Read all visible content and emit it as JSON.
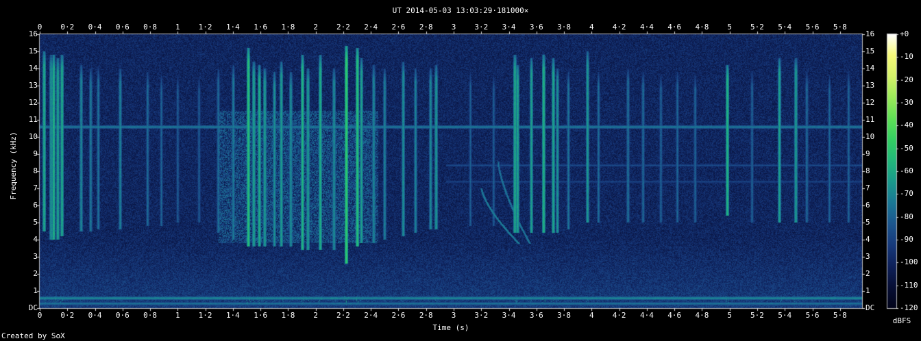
{
  "title": "UT 2014-05-03 13:03:29·181000×",
  "credit": "Created by SoX",
  "chart_data": {
    "type": "heatmap",
    "xlabel": "Time (s)",
    "ylabel": "Frequency (kHz)",
    "xlim": [
      0,
      5.96
    ],
    "ylim": [
      0,
      16
    ],
    "x_ticks": [
      "0",
      "0·2",
      "0·4",
      "0·6",
      "0·8",
      "1",
      "1·2",
      "1·4",
      "1·6",
      "1·8",
      "2",
      "2·2",
      "2·4",
      "2·6",
      "2·8",
      "3",
      "3·2",
      "3·4",
      "3·6",
      "3·8",
      "4",
      "4·2",
      "4·4",
      "4·6",
      "4·8",
      "5",
      "5·2",
      "5·4",
      "5·6",
      "5·8"
    ],
    "y_ticks": [
      "DC",
      "1",
      "2",
      "3",
      "4",
      "5",
      "6",
      "7",
      "8",
      "9",
      "10",
      "11",
      "12",
      "13",
      "14",
      "15",
      "16"
    ],
    "colorbar": {
      "unit": "dBFS",
      "range": [
        -120,
        0
      ],
      "ticks": [
        "+0",
        "-10",
        "-20",
        "-30",
        "-40",
        "-50",
        "-60",
        "-70",
        "-80",
        "-90",
        "-100",
        "-110",
        "-120"
      ],
      "colors": [
        "#ffffff",
        "#f6f97a",
        "#d5f26a",
        "#9cea5a",
        "#5fdf56",
        "#34cf63",
        "#22b87b",
        "#1a9a8c",
        "#1a7896",
        "#1c568e",
        "#173a7c",
        "#0e215a",
        "#070f35",
        "#02041a"
      ]
    },
    "background_level_dBFS": -100,
    "horizontal_lines": [
      {
        "freq_khz": 10.6,
        "level": -72,
        "x_range": [
          0,
          5.96
        ]
      },
      {
        "freq_khz": 8.35,
        "level": -86,
        "x_range": [
          2.95,
          5.96
        ]
      },
      {
        "freq_khz": 7.4,
        "level": -88,
        "x_range": [
          2.95,
          5.96
        ]
      },
      {
        "freq_khz": 0.6,
        "level": -68,
        "x_range": [
          0,
          5.96
        ]
      },
      {
        "freq_khz": 0.3,
        "level": -74,
        "x_range": [
          0,
          5.96
        ]
      }
    ],
    "vertical_impulses": [
      {
        "t": 0.03,
        "f_min": 4.5,
        "f_max": 15.0,
        "level": -58
      },
      {
        "t": 0.08,
        "f_min": 4.0,
        "f_max": 14.8,
        "level": -64
      },
      {
        "t": 0.1,
        "f_min": 4.0,
        "f_max": 14.8,
        "level": -56
      },
      {
        "t": 0.13,
        "f_min": 4.0,
        "f_max": 14.6,
        "level": -60
      },
      {
        "t": 0.16,
        "f_min": 4.2,
        "f_max": 14.8,
        "level": -58
      },
      {
        "t": 0.3,
        "f_min": 4.5,
        "f_max": 14.2,
        "level": -68
      },
      {
        "t": 0.37,
        "f_min": 4.5,
        "f_max": 14.0,
        "level": -72
      },
      {
        "t": 0.42,
        "f_min": 4.6,
        "f_max": 14.0,
        "level": -74
      },
      {
        "t": 0.58,
        "f_min": 4.6,
        "f_max": 14.0,
        "level": -70
      },
      {
        "t": 0.78,
        "f_min": 4.8,
        "f_max": 13.8,
        "level": -76
      },
      {
        "t": 0.88,
        "f_min": 4.8,
        "f_max": 13.6,
        "level": -78
      },
      {
        "t": 1.0,
        "f_min": 5.0,
        "f_max": 13.6,
        "level": -80
      },
      {
        "t": 1.15,
        "f_min": 5.0,
        "f_max": 13.5,
        "level": -80
      },
      {
        "t": 1.29,
        "f_min": 4.4,
        "f_max": 14.0,
        "level": -76
      },
      {
        "t": 1.4,
        "f_min": 4.0,
        "f_max": 14.2,
        "level": -72
      },
      {
        "t": 1.51,
        "f_min": 3.6,
        "f_max": 15.2,
        "level": -52
      },
      {
        "t": 1.55,
        "f_min": 3.6,
        "f_max": 14.4,
        "level": -60
      },
      {
        "t": 1.59,
        "f_min": 3.6,
        "f_max": 14.2,
        "level": -58
      },
      {
        "t": 1.63,
        "f_min": 3.6,
        "f_max": 14.0,
        "level": -62
      },
      {
        "t": 1.7,
        "f_min": 3.6,
        "f_max": 13.8,
        "level": -66
      },
      {
        "t": 1.75,
        "f_min": 3.6,
        "f_max": 14.4,
        "level": -62
      },
      {
        "t": 1.82,
        "f_min": 3.6,
        "f_max": 13.8,
        "level": -66
      },
      {
        "t": 1.9,
        "f_min": 3.4,
        "f_max": 14.8,
        "level": -56
      },
      {
        "t": 1.94,
        "f_min": 3.4,
        "f_max": 14.0,
        "level": -62
      },
      {
        "t": 2.03,
        "f_min": 3.4,
        "f_max": 14.8,
        "level": -58
      },
      {
        "t": 2.13,
        "f_min": 3.4,
        "f_max": 14.0,
        "level": -66
      },
      {
        "t": 2.22,
        "f_min": 2.6,
        "f_max": 15.3,
        "level": -48
      },
      {
        "t": 2.3,
        "f_min": 3.6,
        "f_max": 15.2,
        "level": -52
      },
      {
        "t": 2.33,
        "f_min": 3.8,
        "f_max": 14.6,
        "level": -62
      },
      {
        "t": 2.42,
        "f_min": 3.8,
        "f_max": 14.2,
        "level": -68
      },
      {
        "t": 2.5,
        "f_min": 4.0,
        "f_max": 14.0,
        "level": -70
      },
      {
        "t": 2.63,
        "f_min": 4.2,
        "f_max": 14.4,
        "level": -66
      },
      {
        "t": 2.72,
        "f_min": 4.4,
        "f_max": 14.0,
        "level": -70
      },
      {
        "t": 2.83,
        "f_min": 4.6,
        "f_max": 14.0,
        "level": -68
      },
      {
        "t": 2.87,
        "f_min": 4.6,
        "f_max": 14.2,
        "level": -64
      },
      {
        "t": 3.12,
        "f_min": 4.8,
        "f_max": 13.8,
        "level": -80
      },
      {
        "t": 3.29,
        "f_min": 4.8,
        "f_max": 13.6,
        "level": -80
      },
      {
        "t": 3.44,
        "f_min": 4.4,
        "f_max": 14.8,
        "level": -58
      },
      {
        "t": 3.46,
        "f_min": 4.4,
        "f_max": 14.2,
        "level": -60
      },
      {
        "t": 3.56,
        "f_min": 4.4,
        "f_max": 14.6,
        "level": -62
      },
      {
        "t": 3.65,
        "f_min": 4.4,
        "f_max": 14.8,
        "level": -56
      },
      {
        "t": 3.72,
        "f_min": 4.4,
        "f_max": 14.6,
        "level": -60
      },
      {
        "t": 3.75,
        "f_min": 4.4,
        "f_max": 14.0,
        "level": -66
      },
      {
        "t": 3.83,
        "f_min": 4.6,
        "f_max": 13.8,
        "level": -74
      },
      {
        "t": 3.97,
        "f_min": 5.0,
        "f_max": 15.0,
        "level": -64
      },
      {
        "t": 4.05,
        "f_min": 5.0,
        "f_max": 13.8,
        "level": -76
      },
      {
        "t": 4.26,
        "f_min": 5.0,
        "f_max": 14.0,
        "level": -74
      },
      {
        "t": 4.37,
        "f_min": 5.0,
        "f_max": 13.8,
        "level": -76
      },
      {
        "t": 4.5,
        "f_min": 5.0,
        "f_max": 13.6,
        "level": -78
      },
      {
        "t": 4.62,
        "f_min": 5.0,
        "f_max": 13.8,
        "level": -78
      },
      {
        "t": 4.75,
        "f_min": 5.0,
        "f_max": 13.6,
        "level": -78
      },
      {
        "t": 4.98,
        "f_min": 5.4,
        "f_max": 14.2,
        "level": -56
      },
      {
        "t": 5.16,
        "f_min": 5.0,
        "f_max": 13.8,
        "level": -78
      },
      {
        "t": 5.36,
        "f_min": 5.0,
        "f_max": 14.6,
        "level": -62
      },
      {
        "t": 5.48,
        "f_min": 5.0,
        "f_max": 14.6,
        "level": -62
      },
      {
        "t": 5.56,
        "f_min": 5.0,
        "f_max": 13.8,
        "level": -76
      },
      {
        "t": 5.72,
        "f_min": 5.0,
        "f_max": 13.6,
        "level": -78
      },
      {
        "t": 5.86,
        "f_min": 5.0,
        "f_max": 13.8,
        "level": -78
      }
    ],
    "diffuse_region": {
      "t_range": [
        1.3,
        2.45
      ],
      "f_range": [
        3.8,
        11.5
      ],
      "level": -82
    },
    "low_band": {
      "f_range": [
        0,
        4.0
      ],
      "level": -92
    },
    "chirps": [
      {
        "t_start": 3.2,
        "f_start": 7.0,
        "t_end": 3.47,
        "f_end": 3.8,
        "level": -74
      },
      {
        "t_start": 3.32,
        "f_start": 8.6,
        "t_end": 3.55,
        "f_end": 3.8,
        "level": -76
      }
    ]
  }
}
